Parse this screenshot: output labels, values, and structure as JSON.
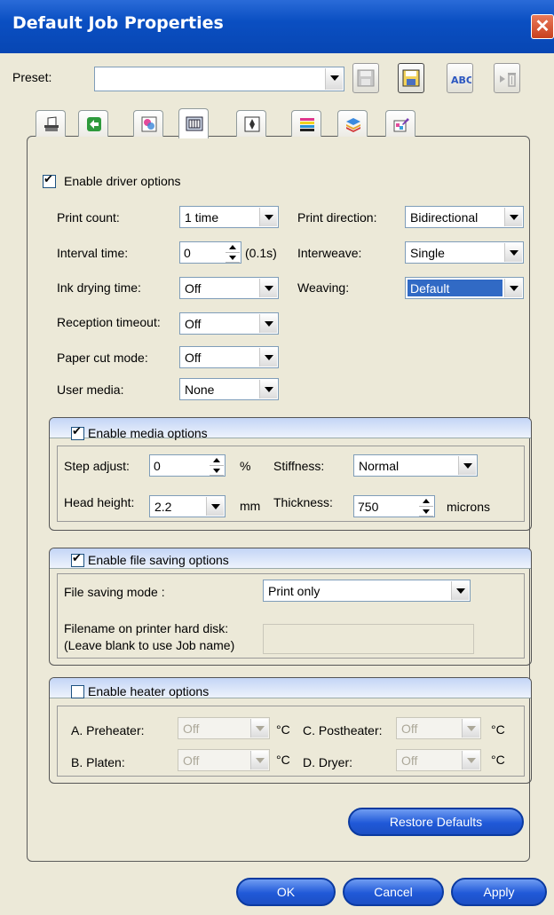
{
  "window": {
    "title": "Default Job Properties"
  },
  "preset": {
    "label": "Preset:",
    "value": ""
  },
  "tabs": [
    {
      "icon": "printer-icon"
    },
    {
      "icon": "arrows-icon"
    },
    {
      "icon": "color-icon"
    },
    {
      "icon": "print-head-icon"
    },
    {
      "icon": "layout-icon"
    },
    {
      "icon": "color-bars-icon"
    },
    {
      "icon": "layers-icon"
    },
    {
      "icon": "eyedropper-icon"
    }
  ],
  "driver": {
    "enable_label": "Enable driver options",
    "enabled": true,
    "print_count": {
      "label": "Print count:",
      "value": "1 time"
    },
    "interval_time": {
      "label": "Interval time:",
      "value": "0",
      "unit": "(0.1s)"
    },
    "ink_drying": {
      "label": "Ink drying time:",
      "value": "Off"
    },
    "reception_timeout": {
      "label": "Reception timeout:",
      "value": "Off"
    },
    "paper_cut": {
      "label": "Paper cut mode:",
      "value": "Off"
    },
    "user_media": {
      "label": "User media:",
      "value": "None"
    },
    "print_direction": {
      "label": "Print direction:",
      "value": "Bidirectional"
    },
    "interweave": {
      "label": "Interweave:",
      "value": "Single"
    },
    "weaving": {
      "label": "Weaving:",
      "value": "Default"
    }
  },
  "media": {
    "enable_label": "Enable media options",
    "enabled": true,
    "step_adjust": {
      "label": "Step adjust:",
      "value": "0",
      "unit": "%"
    },
    "stiffness": {
      "label": "Stiffness:",
      "value": "Normal"
    },
    "head_height": {
      "label": "Head height:",
      "value": "2.2",
      "unit": "mm"
    },
    "thickness": {
      "label": "Thickness:",
      "value": "750",
      "unit": "microns"
    }
  },
  "file_saving": {
    "enable_label": "Enable file saving options",
    "enabled": true,
    "mode": {
      "label": "File saving mode :",
      "value": "Print only"
    },
    "filename_label_1": "Filename on printer hard disk:",
    "filename_label_2": "(Leave blank to use Job name)",
    "filename_value": ""
  },
  "heater": {
    "enable_label": "Enable heater options",
    "enabled": false,
    "preheater": {
      "label": "A. Preheater:",
      "value": "Off",
      "unit": "°C"
    },
    "platen": {
      "label": "B. Platen:",
      "value": "Off",
      "unit": "°C"
    },
    "postheater": {
      "label": "C. Postheater:",
      "value": "Off",
      "unit": "°C"
    },
    "dryer": {
      "label": "D. Dryer:",
      "value": "Off",
      "unit": "°C"
    }
  },
  "buttons": {
    "restore": "Restore Defaults",
    "ok": "OK",
    "cancel": "Cancel",
    "apply": "Apply"
  }
}
